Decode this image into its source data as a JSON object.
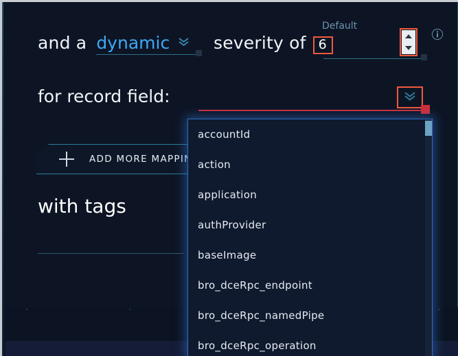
{
  "row_dynamic": {
    "prefix_text": "and a",
    "select_value": "dynamic",
    "chevron_icon": "chevron-down-icon"
  },
  "row_severity": {
    "label": "severity of",
    "default_label": "Default",
    "value": "6",
    "spinner_up_icon": "triangle-up-icon",
    "spinner_down_icon": "triangle-down-icon",
    "info_icon": "info-circle-icon"
  },
  "row_record_field": {
    "label": "for record field:",
    "chevron_icon": "chevron-down-icon",
    "value": ""
  },
  "add_mapping": {
    "label": "ADD MORE MAPPING",
    "plus_icon": "plus-icon"
  },
  "tags": {
    "heading": "with tags"
  },
  "dropdown": {
    "items": [
      "accountId",
      "action",
      "application",
      "authProvider",
      "baseImage",
      "bro_dceRpc_endpoint",
      "bro_dceRpc_namedPipe",
      "bro_dceRpc_operation"
    ]
  },
  "colors": {
    "background": "#0d1525",
    "accent_blue": "#3da9f5",
    "accent_teal": "#2d7e96",
    "highlight_red": "#f4593c",
    "error_red": "#d0303a",
    "dropdown_border": "#2f6fc4",
    "muted_label": "#6d93b0",
    "scrollbar_thumb": "#6ba3c4"
  }
}
